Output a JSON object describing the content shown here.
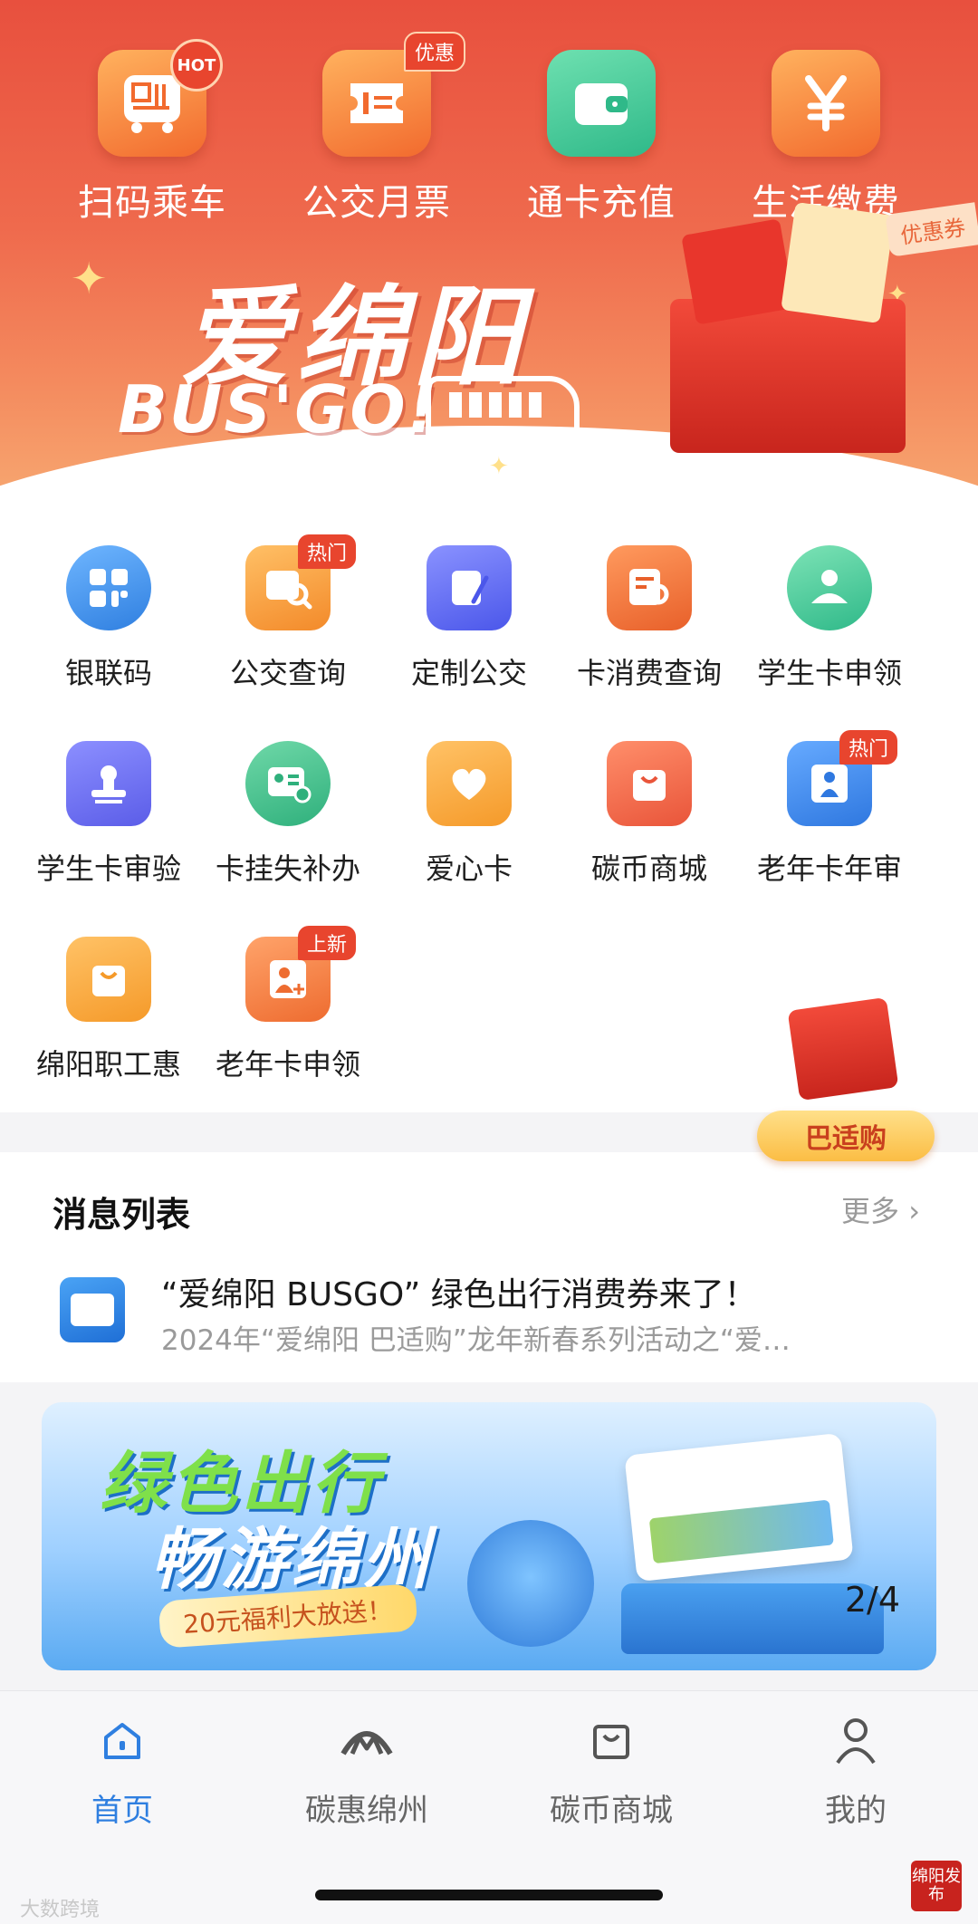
{
  "top_services": [
    {
      "label": "扫码乘车",
      "icon": "qr-bus-icon",
      "badge": "HOT"
    },
    {
      "label": "公交月票",
      "icon": "ticket-icon",
      "badge": "优惠"
    },
    {
      "label": "通卡充值",
      "icon": "wallet-icon",
      "badge": ""
    },
    {
      "label": "生活缴费",
      "icon": "yen-icon",
      "badge": ""
    }
  ],
  "hero_banner": {
    "title": "爱绵阳",
    "subtitle": "BUS'GO!",
    "coupon": "优惠券"
  },
  "services": [
    {
      "label": "银联码",
      "icon": "unionpay-grid-icon",
      "color": "#3a8ef0",
      "badge": ""
    },
    {
      "label": "公交查询",
      "icon": "bus-search-icon",
      "color": "#f59a3a",
      "badge": "热门"
    },
    {
      "label": "定制公交",
      "icon": "custom-bus-icon",
      "color": "#5b6cf2",
      "badge": ""
    },
    {
      "label": "卡消费查询",
      "icon": "card-search-icon",
      "color": "#f07a3a",
      "badge": ""
    },
    {
      "label": "学生卡申领",
      "icon": "student-apply-icon",
      "color": "#3cc48e",
      "badge": ""
    },
    {
      "label": "学生卡审验",
      "icon": "stamp-icon",
      "color": "#6a6cf0",
      "badge": ""
    },
    {
      "label": "卡挂失补办",
      "icon": "id-card-icon",
      "color": "#3cba86",
      "badge": ""
    },
    {
      "label": "爱心卡",
      "icon": "heart-icon",
      "color": "#f7a93a",
      "badge": ""
    },
    {
      "label": "碳币商城",
      "icon": "shopping-bag-icon",
      "color": "#ef6a4a",
      "badge": ""
    },
    {
      "label": "老年卡年审",
      "icon": "elder-icon",
      "color": "#3a8ef0",
      "badge": "热门"
    },
    {
      "label": "绵阳职工惠",
      "icon": "gift-bag-icon",
      "color": "#f59a3a",
      "badge": ""
    },
    {
      "label": "老年卡申领",
      "icon": "elder-add-icon",
      "color": "#f07a3a",
      "badge": "上新"
    }
  ],
  "float_button": {
    "label": "巴适购"
  },
  "messages": {
    "title": "消息列表",
    "more": "更多",
    "items": [
      {
        "title": "“爱绵阳 BUSGO” 绿色出行消费券来了！",
        "summary": "2024年“爱绵阳 巴适购”龙年新春系列活动之“爱…"
      }
    ]
  },
  "promo": {
    "line1": "绿色出行",
    "line2": "畅游绵州",
    "line3": "20元福利大放送！",
    "pager": "2/4"
  },
  "bottom_nav": [
    {
      "label": "首页",
      "icon": "home-icon",
      "active": true
    },
    {
      "label": "碳惠绵州",
      "icon": "carbon-logo-icon",
      "active": false
    },
    {
      "label": "碳币商城",
      "icon": "shopping-bag-icon",
      "active": false
    },
    {
      "label": "我的",
      "icon": "user-icon",
      "active": false
    }
  ],
  "watermarks": {
    "left": "大数跨境",
    "seal": "绵阳发布"
  },
  "colors": {
    "hero_red": "#e8503e",
    "accent_blue": "#2f7fe0",
    "badge_red": "#e8452e"
  }
}
